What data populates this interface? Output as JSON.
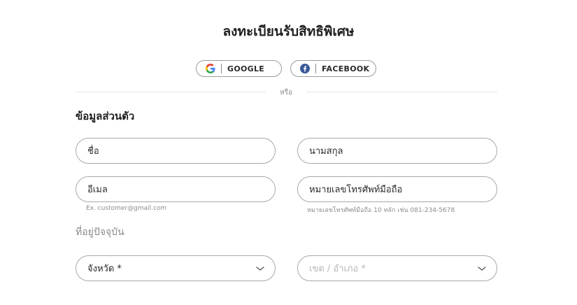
{
  "header": {
    "title": "ลงทะเบียนรับสิทธิพิเศษ"
  },
  "social": {
    "google_label": "GOOGLE",
    "facebook_label": "FACEBOOK",
    "or_text": "หรือ"
  },
  "personal": {
    "heading": "ข้อมูลส่วนตัว",
    "first_name_placeholder": "ชื่อ",
    "last_name_placeholder": "นามสกุล",
    "email_placeholder": "อีเมล",
    "email_hint": "Ex. customer@gmail.com",
    "phone_placeholder": "หมายเลขโทรศัพท์มือถือ",
    "phone_hint": "หมายเลขโทรศัพท์มือถือ 10 หลัก เช่น 081-234-5678"
  },
  "address": {
    "heading": "ที่อยู่ปัจจุบัน",
    "province_value": "จังหวัด *",
    "district_placeholder": "เขต / อำเภอ *"
  },
  "colors": {
    "google_blue": "#4285F4",
    "google_red": "#EA4335",
    "google_yellow": "#FBBC05",
    "google_green": "#34A853",
    "facebook_blue": "#3b5998"
  },
  "icons": [
    "google-icon",
    "facebook-icon",
    "chevron-down-icon"
  ]
}
